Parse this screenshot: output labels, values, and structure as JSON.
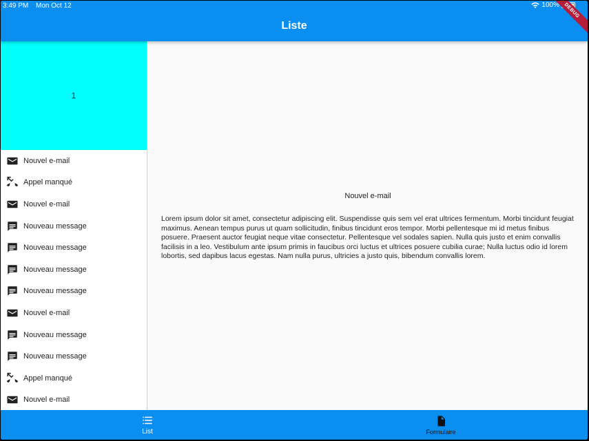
{
  "status": {
    "time": "3:49 PM",
    "date": "Mon Oct 12",
    "battery": "100%"
  },
  "appbar": {
    "title": "Liste",
    "debug": "DEBUG"
  },
  "sidebar": {
    "header_number": "1",
    "items": [
      {
        "icon": "email-icon",
        "label": "Nouvel e-mail"
      },
      {
        "icon": "missed-call-icon",
        "label": "Appel manqué"
      },
      {
        "icon": "email-icon",
        "label": "Nouvel e-mail"
      },
      {
        "icon": "message-icon",
        "label": "Nouveau message"
      },
      {
        "icon": "message-icon",
        "label": "Nouveau message"
      },
      {
        "icon": "message-icon",
        "label": "Nouveau message"
      },
      {
        "icon": "message-icon",
        "label": "Nouveau message"
      },
      {
        "icon": "email-icon",
        "label": "Nouvel e-mail"
      },
      {
        "icon": "message-icon",
        "label": "Nouveau message"
      },
      {
        "icon": "message-icon",
        "label": "Nouveau message"
      },
      {
        "icon": "missed-call-icon",
        "label": "Appel manqué"
      },
      {
        "icon": "email-icon",
        "label": "Nouvel e-mail"
      }
    ]
  },
  "detail": {
    "title": "Nouvel e-mail",
    "body": "Lorem ipsum dolor sit amet, consectetur adipiscing elit. Suspendisse quis sem vel erat ultrices fermentum. Morbi tincidunt feugiat maximus. Aenean tempus purus ut quam sollicitudin, finibus tincidunt eros tempor. Morbi pellentesque mi id metus finibus posuere. Praesent auctor feugiat neque vitae consectetur. Pellentesque vel sodales sapien. Nulla quis justo et enim convallis facilisis in a leo. Vestibulum ante ipsum primis in faucibus orci luctus et ultrices posuere cubilia curae; Nulla luctus odio id lorem lobortis, sed dapibus lacus egestas. Nam nulla purus, ultricies a justo quis, bibendum convallis lorem."
  },
  "bottom_nav": {
    "tabs": [
      {
        "icon": "list-icon",
        "label": "List",
        "selected": true
      },
      {
        "icon": "document-icon",
        "label": "Formulaire",
        "selected": false
      }
    ]
  },
  "colors": {
    "primary": "#0a8ef0",
    "header_card": "#00ffff",
    "debug_banner": "#b71c3a"
  }
}
